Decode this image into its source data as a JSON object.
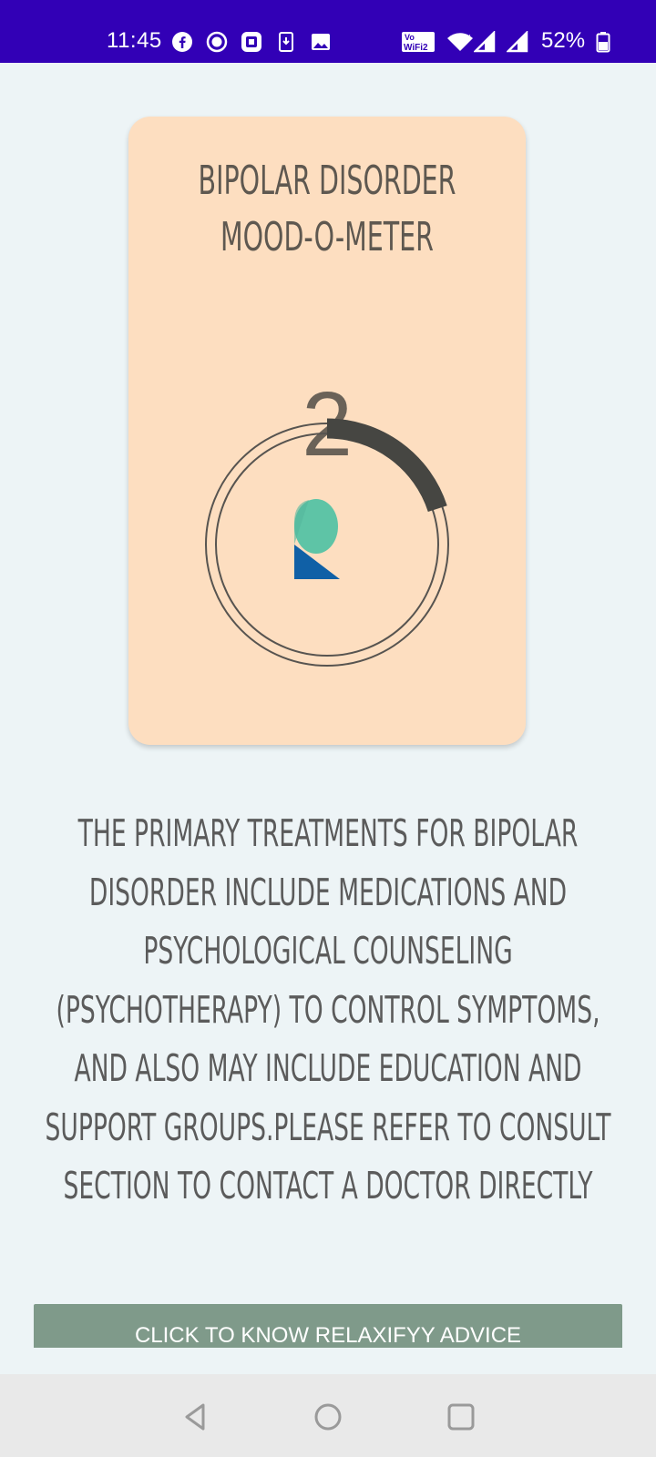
{
  "status_bar": {
    "time": "11:45",
    "left_icons": [
      "facebook-icon",
      "record-icon",
      "app-icon",
      "download-icon",
      "image-icon"
    ],
    "right_icons": [
      "vowifi-icon",
      "wifi-icon",
      "signal-icon",
      "signal-icon",
      "battery-icon"
    ],
    "battery_percent": "52%",
    "background_color": "#3200b6"
  },
  "card": {
    "title": "BIPOLAR DISORDER\nMOOD-O-METER",
    "mood_value": "2",
    "meter_progress_fraction": 0.2,
    "colors": {
      "background": "#fddec0",
      "progress": "#464642",
      "logo_top": "#5ec4a6",
      "logo_bottom": "#1060a6"
    }
  },
  "info": {
    "text": "THE PRIMARY TREATMENTS FOR BIPOLAR DISORDER INCLUDE MEDICATIONS AND PSYCHOLOGICAL COUNSELING (PSYCHOTHERAPY) TO CONTROL SYMPTOMS, AND ALSO MAY INCLUDE EDUCATION AND SUPPORT GROUPS.PLEASE REFER TO CONSULT SECTION TO CONTACT A DOCTOR DIRECTLY"
  },
  "advice_button": {
    "label": "CLICK TO KNOW RELAXIFYY ADVICE",
    "color": "#7f9a8a"
  },
  "nav_bar": {
    "buttons": [
      "back-icon",
      "home-icon",
      "recents-icon"
    ]
  }
}
